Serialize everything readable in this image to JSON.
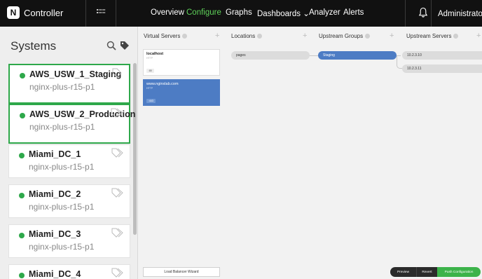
{
  "app": {
    "title": "Controller",
    "logo_letter": "N"
  },
  "nav": {
    "items": [
      {
        "label": "Overview",
        "active": false
      },
      {
        "label": "Configure",
        "active": true
      },
      {
        "label": "Graphs",
        "active": false
      },
      {
        "label": "Dashboards ⌄",
        "active": false
      },
      {
        "label": "Analyzer",
        "active": false
      },
      {
        "label": "Alerts",
        "active": false
      }
    ],
    "user": "Administrator ⌄",
    "accent_color": "#5fd35a"
  },
  "sidebar": {
    "title": "Systems",
    "systems": [
      {
        "name": "AWS_USW_1_Staging",
        "version": "nginx-plus-r15-p1",
        "selected": true
      },
      {
        "name": "AWS_USW_2_Production",
        "version": "nginx-plus-r15-p1",
        "selected": true
      },
      {
        "name": "Miami_DC_1",
        "version": "nginx-plus-r15-p1",
        "selected": false
      },
      {
        "name": "Miami_DC_2",
        "version": "nginx-plus-r15-p1",
        "selected": false
      },
      {
        "name": "Miami_DC_3",
        "version": "nginx-plus-r15-p1",
        "selected": false
      },
      {
        "name": "Miami_DC_4",
        "version": "",
        "selected": false
      }
    ],
    "status_color": "#2ea84a"
  },
  "columns": {
    "virtual_servers": "Virtual Servers",
    "locations": "Locations",
    "upstream_groups": "Upstream Groups",
    "upstream_servers": "Upstream Servers",
    "add_symbol": "+"
  },
  "virtual_servers": [
    {
      "name": "localhost",
      "protocol": "HTTP",
      "port": ":80",
      "selected": false
    },
    {
      "name": "www.nginxlab.com",
      "protocol": "HTTP",
      "port": ":443",
      "selected": true
    }
  ],
  "locations": [
    {
      "label": "pages"
    }
  ],
  "upstream_groups": [
    {
      "label": "Staging"
    }
  ],
  "upstream_servers": [
    {
      "label": "10.2.3.10"
    },
    {
      "label": "10.2.3.11"
    }
  ],
  "footer": {
    "wizard_label": "Load Balancer Wizard",
    "preview_label": "Preview",
    "revert_label": "Revert",
    "push_label": "Push Configuration"
  }
}
